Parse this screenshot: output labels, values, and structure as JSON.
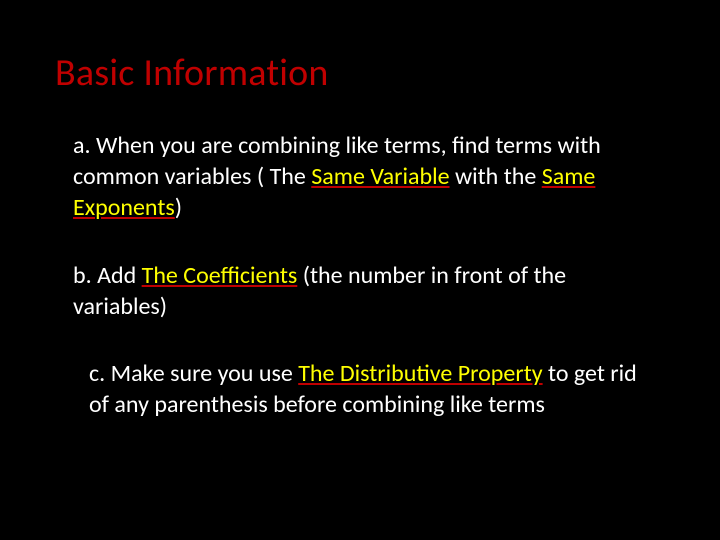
{
  "title": "Basic Information",
  "a": {
    "t1": "a. When you are combining like terms, find terms with common variables ( The ",
    "h1": "Same Variable",
    "t2": " with the ",
    "h2": "Same Exponents",
    "t3": ")"
  },
  "b": {
    "t1": "b. Add ",
    "h1": "The Coefficients",
    "t2": " (the number in front of the variables)"
  },
  "c": {
    "t1": "c. Make sure you use ",
    "h1": "The Distributive Property",
    "t2": " to get rid of any parenthesis before combining like terms"
  }
}
